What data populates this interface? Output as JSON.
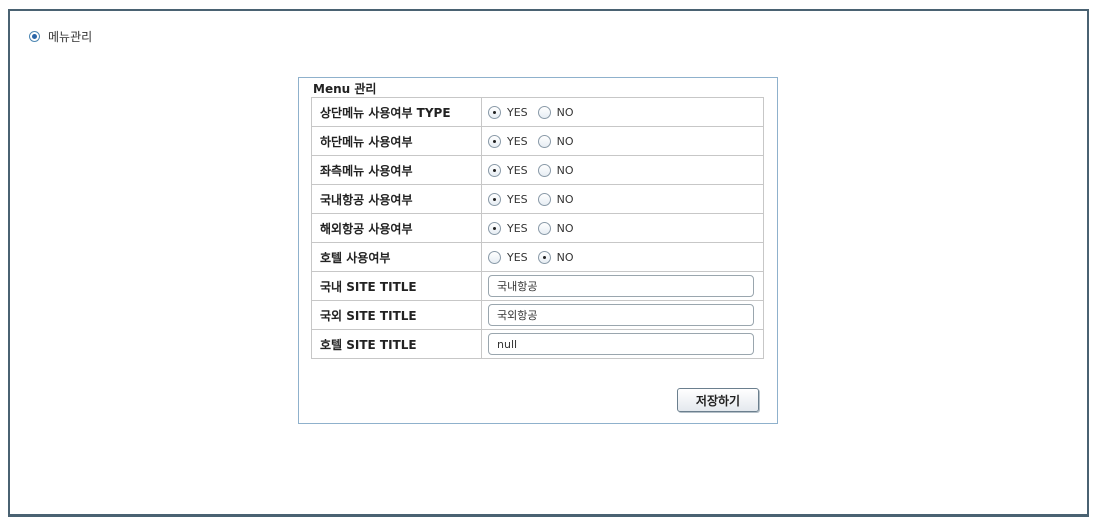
{
  "page": {
    "heading": "메뉴관리"
  },
  "panel": {
    "title": "Menu 관리"
  },
  "rows": [
    {
      "label": "상단메뉴 사용여부 TYPE",
      "selected": "YES"
    },
    {
      "label": "하단메뉴 사용여부",
      "selected": "YES"
    },
    {
      "label": "좌측메뉴 사용여부",
      "selected": "YES"
    },
    {
      "label": "국내항공 사용여부",
      "selected": "YES"
    },
    {
      "label": "해외항공 사용여부",
      "selected": "YES"
    },
    {
      "label": "호텔 사용여부",
      "selected": "NO"
    }
  ],
  "options": {
    "yes": "YES",
    "no": "NO"
  },
  "titles": [
    {
      "label": "국내 SITE TITLE",
      "value": "국내항공"
    },
    {
      "label": "국외 SITE TITLE",
      "value": "국외항공"
    },
    {
      "label": "호텔 SITE TITLE",
      "value": "null"
    }
  ],
  "actions": {
    "save_label": "저장하기"
  }
}
